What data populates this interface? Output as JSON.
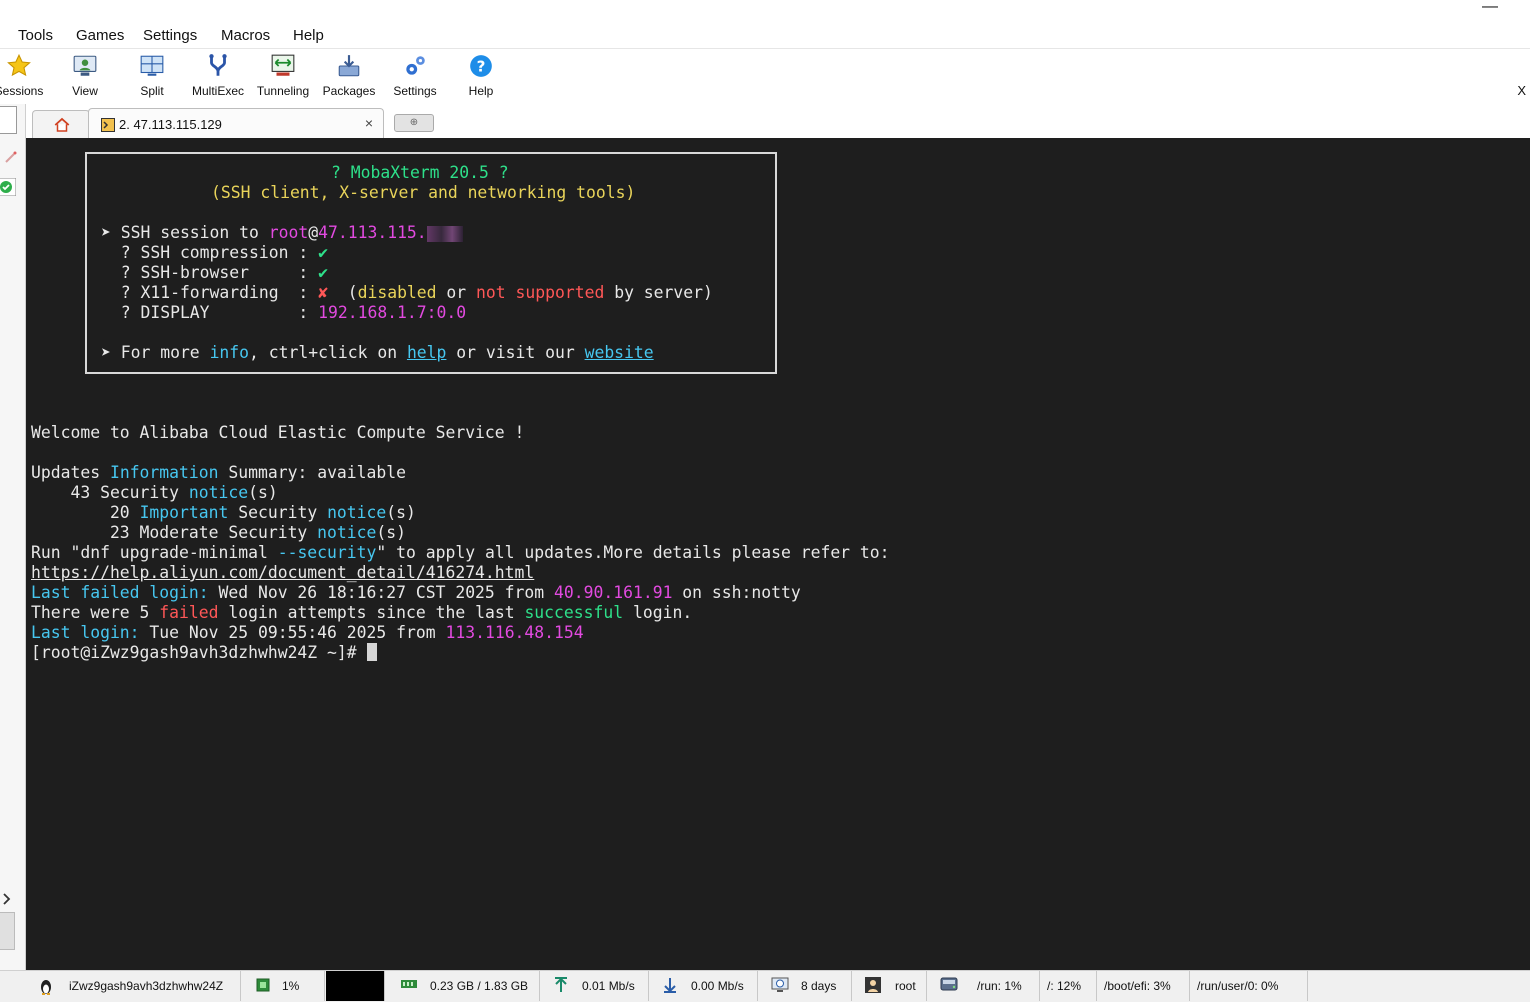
{
  "menu": [
    "Tools",
    "Games",
    "Settings",
    "Macros",
    "Help"
  ],
  "toolbar": {
    "items": [
      {
        "label": "Sessions",
        "icon": "star-icon"
      },
      {
        "label": "View",
        "icon": "view-icon"
      },
      {
        "label": "Split",
        "icon": "split-icon"
      },
      {
        "label": "MultiExec",
        "icon": "multiexec-icon"
      },
      {
        "label": "Tunneling",
        "icon": "tunneling-icon"
      },
      {
        "label": "Packages",
        "icon": "packages-icon"
      },
      {
        "label": "Settings",
        "icon": "gear-icon"
      },
      {
        "label": "Help",
        "icon": "help-icon"
      }
    ],
    "close_x": "X"
  },
  "tabs": {
    "ssh_label": "2. 47.113.115.129",
    "close": "×",
    "new": "⊕"
  },
  "terminal": {
    "banner": {
      "title": "? MobaXterm 20.5 ?",
      "subtitle": "(SSH client, X-server and networking tools)",
      "session_prefix": "➤ SSH session to ",
      "session_user": "root",
      "session_at": "@",
      "session_host": "47.113.115.",
      "compression_label": "  ? SSH compression : ",
      "check": "✔",
      "browser_label": "  ? SSH-browser     : ",
      "x11_label": "  ? X11-forwarding  : ",
      "cross": "✘",
      "x11_open": "  (",
      "x11_disabled": "disabled",
      "x11_or": " or ",
      "x11_not_supported": "not supported",
      "x11_tail": " by server)",
      "display_label": "  ? DISPLAY         : ",
      "display_value": "192.168.1.7:0.0",
      "more_prefix": "➤ For more ",
      "more_info": "info",
      "more_mid": ", ctrl+click on ",
      "more_help": "help",
      "more_mid2": " or visit our ",
      "more_website": "website"
    },
    "welcome": "Welcome to Alibaba Cloud Elastic Compute Service !",
    "updates_a": "Updates ",
    "updates_info": "Information",
    "updates_b": " Summary: available",
    "sec_a": "    43 Security ",
    "notice": "notice",
    "notice_suffix": "(s)",
    "imp_a": "        20 ",
    "imp_important": "Important",
    "imp_b": " Security ",
    "mod_a": "        23 Moderate Security ",
    "run_a": "Run \"dnf upgrade-minimal ",
    "run_security": "--security",
    "run_b": "\" to apply all updates.More details please refer to:",
    "url": "https://help.aliyun.com/document_detail/416274.html",
    "failed_label": "Last failed login:",
    "failed_date": " Wed Nov 26 18:16:27 CST 2025 from ",
    "failed_ip": "40.90.161.91",
    "failed_tail": " on ssh:notty",
    "there_a": "There were 5 ",
    "there_failed": "failed",
    "there_b": " login attempts since the last ",
    "there_successful": "successful",
    "there_c": " login.",
    "last_label": "Last login:",
    "last_date": " Tue Nov 25 09:55:46 2025 from ",
    "last_ip": "113.116.48.154",
    "prompt": "[root@iZwz9gash9avh3dzhwhw24Z ~]# "
  },
  "status": {
    "hostname": "iZwz9gash9avh3dzhwhw24Z",
    "cpu": "1%",
    "memory": "0.23 GB / 1.83 GB",
    "upload": "0.01 Mb/s",
    "download": "0.00 Mb/s",
    "uptime": "8 days",
    "user": "root",
    "run": "/run: 1%",
    "root_fs": "/: 12%",
    "boot_efi": "/boot/efi: 3%",
    "run_user": "/run/user/0: 0%"
  }
}
